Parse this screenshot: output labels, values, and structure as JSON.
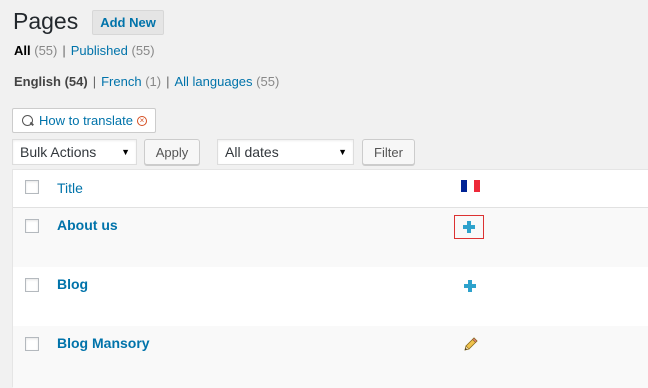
{
  "header": {
    "title": "Pages",
    "add_new": "Add New"
  },
  "status_links": [
    {
      "label": "All",
      "count": "(55)"
    },
    {
      "label": "Published",
      "count": "(55)"
    }
  ],
  "language_links": [
    {
      "label": "English",
      "count": "(54)"
    },
    {
      "label": "French",
      "count": "(1)"
    },
    {
      "label": "All languages",
      "count": "(55)"
    }
  ],
  "separator": "|",
  "howto": {
    "label": "How to translate",
    "close": "×"
  },
  "tablenav": {
    "bulk_actions": "Bulk Actions",
    "apply": "Apply",
    "dates": "All dates",
    "filter": "Filter"
  },
  "table": {
    "title_column": "Title",
    "language_column_flag": "fr",
    "rows": [
      {
        "title": "About us",
        "translation": "add",
        "highlighted": true
      },
      {
        "title": "Blog",
        "translation": "add",
        "highlighted": false
      },
      {
        "title": "Blog Mansory",
        "translation": "edit",
        "highlighted": false
      }
    ]
  },
  "colors": {
    "link": "#0073aa",
    "plus": "#2ea2cc",
    "highlight_border": "#dc3232",
    "flag_blue": "#002395",
    "flag_white": "#ffffff",
    "flag_red": "#ed2939"
  }
}
